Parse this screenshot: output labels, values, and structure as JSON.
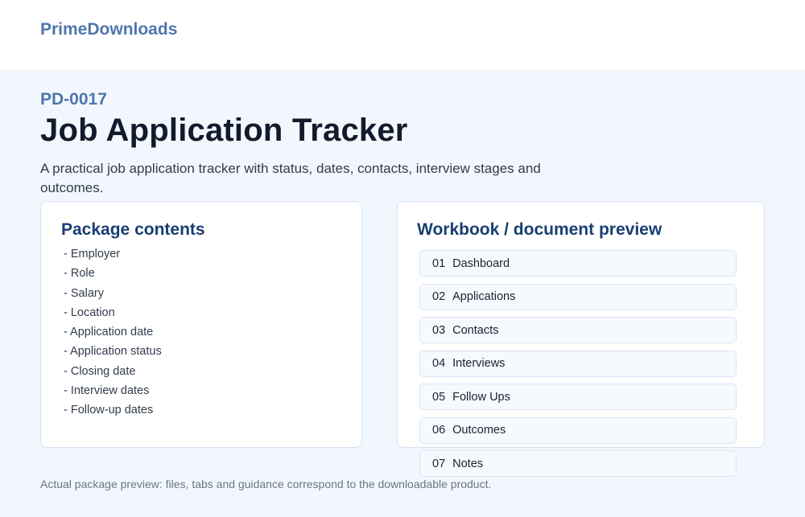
{
  "header": {
    "brand": "PrimeDownloads"
  },
  "product": {
    "code": "PD-0017",
    "title": "Job Application Tracker",
    "description": "A practical job application tracker with status, dates, contacts, interview stages and outcomes."
  },
  "contents": {
    "title": "Package contents",
    "items": [
      "- Employer",
      "- Role",
      "- Salary",
      "- Location",
      "- Application date",
      "- Application status",
      "- Closing date",
      "- Interview dates",
      "- Follow-up dates"
    ]
  },
  "preview": {
    "title": "Workbook / document preview",
    "items": [
      {
        "num": "01",
        "label": "Dashboard"
      },
      {
        "num": "02",
        "label": "Applications"
      },
      {
        "num": "03",
        "label": "Contacts"
      },
      {
        "num": "04",
        "label": "Interviews"
      },
      {
        "num": "05",
        "label": "Follow Ups"
      },
      {
        "num": "06",
        "label": "Outcomes"
      },
      {
        "num": "07",
        "label": "Notes"
      }
    ]
  },
  "footnote": "Actual package preview: files, tabs and guidance correspond to the downloadable product."
}
